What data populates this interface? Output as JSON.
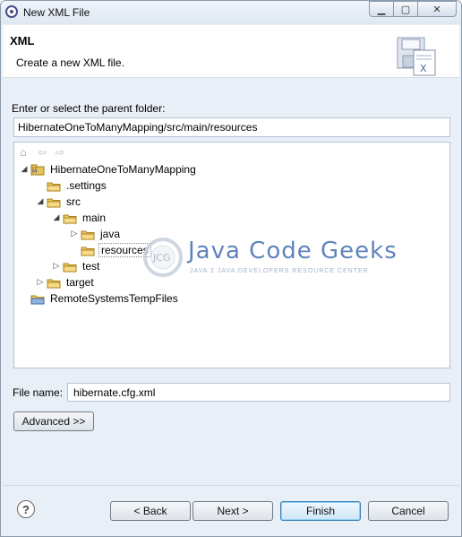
{
  "window": {
    "title": "New XML File"
  },
  "header": {
    "title": "XML",
    "description": "Create a new XML file."
  },
  "parent_folder": {
    "label": "Enter or select the parent folder:",
    "value": "HibernateOneToManyMapping/src/main/resources"
  },
  "tree": {
    "nodes": [
      {
        "label": "HibernateOneToManyMapping",
        "twisty": "◢",
        "icon": "project-icon"
      },
      {
        "label": ".settings",
        "twisty": "",
        "icon": "folder-icon"
      },
      {
        "label": "src",
        "twisty": "◢",
        "icon": "folder-icon"
      },
      {
        "label": "main",
        "twisty": "◢",
        "icon": "folder-icon"
      },
      {
        "label": "java",
        "twisty": "▷",
        "icon": "folder-icon"
      },
      {
        "label": "resources",
        "twisty": "",
        "icon": "folder-icon",
        "selected": true
      },
      {
        "label": "test",
        "twisty": "▷",
        "icon": "folder-icon"
      },
      {
        "label": "target",
        "twisty": "▷",
        "icon": "folder-icon"
      },
      {
        "label": "RemoteSystemsTempFiles",
        "twisty": "",
        "icon": "project-folder-icon"
      }
    ]
  },
  "watermark": {
    "main": "Java Code Geeks",
    "sub": "JAVA 2 JAVA DEVELOPERS RESOURCE CENTER",
    "logo": "JCG"
  },
  "file_name": {
    "label": "File name:",
    "value": "hibernate.cfg.xml"
  },
  "buttons": {
    "advanced": "Advanced >>",
    "back": "< Back",
    "next": "Next >",
    "finish": "Finish",
    "cancel": "Cancel",
    "help": "?"
  },
  "colors": {
    "accent": "#3c7fb1",
    "folder": "#e8c35a",
    "watermark": "#4f76b5"
  }
}
